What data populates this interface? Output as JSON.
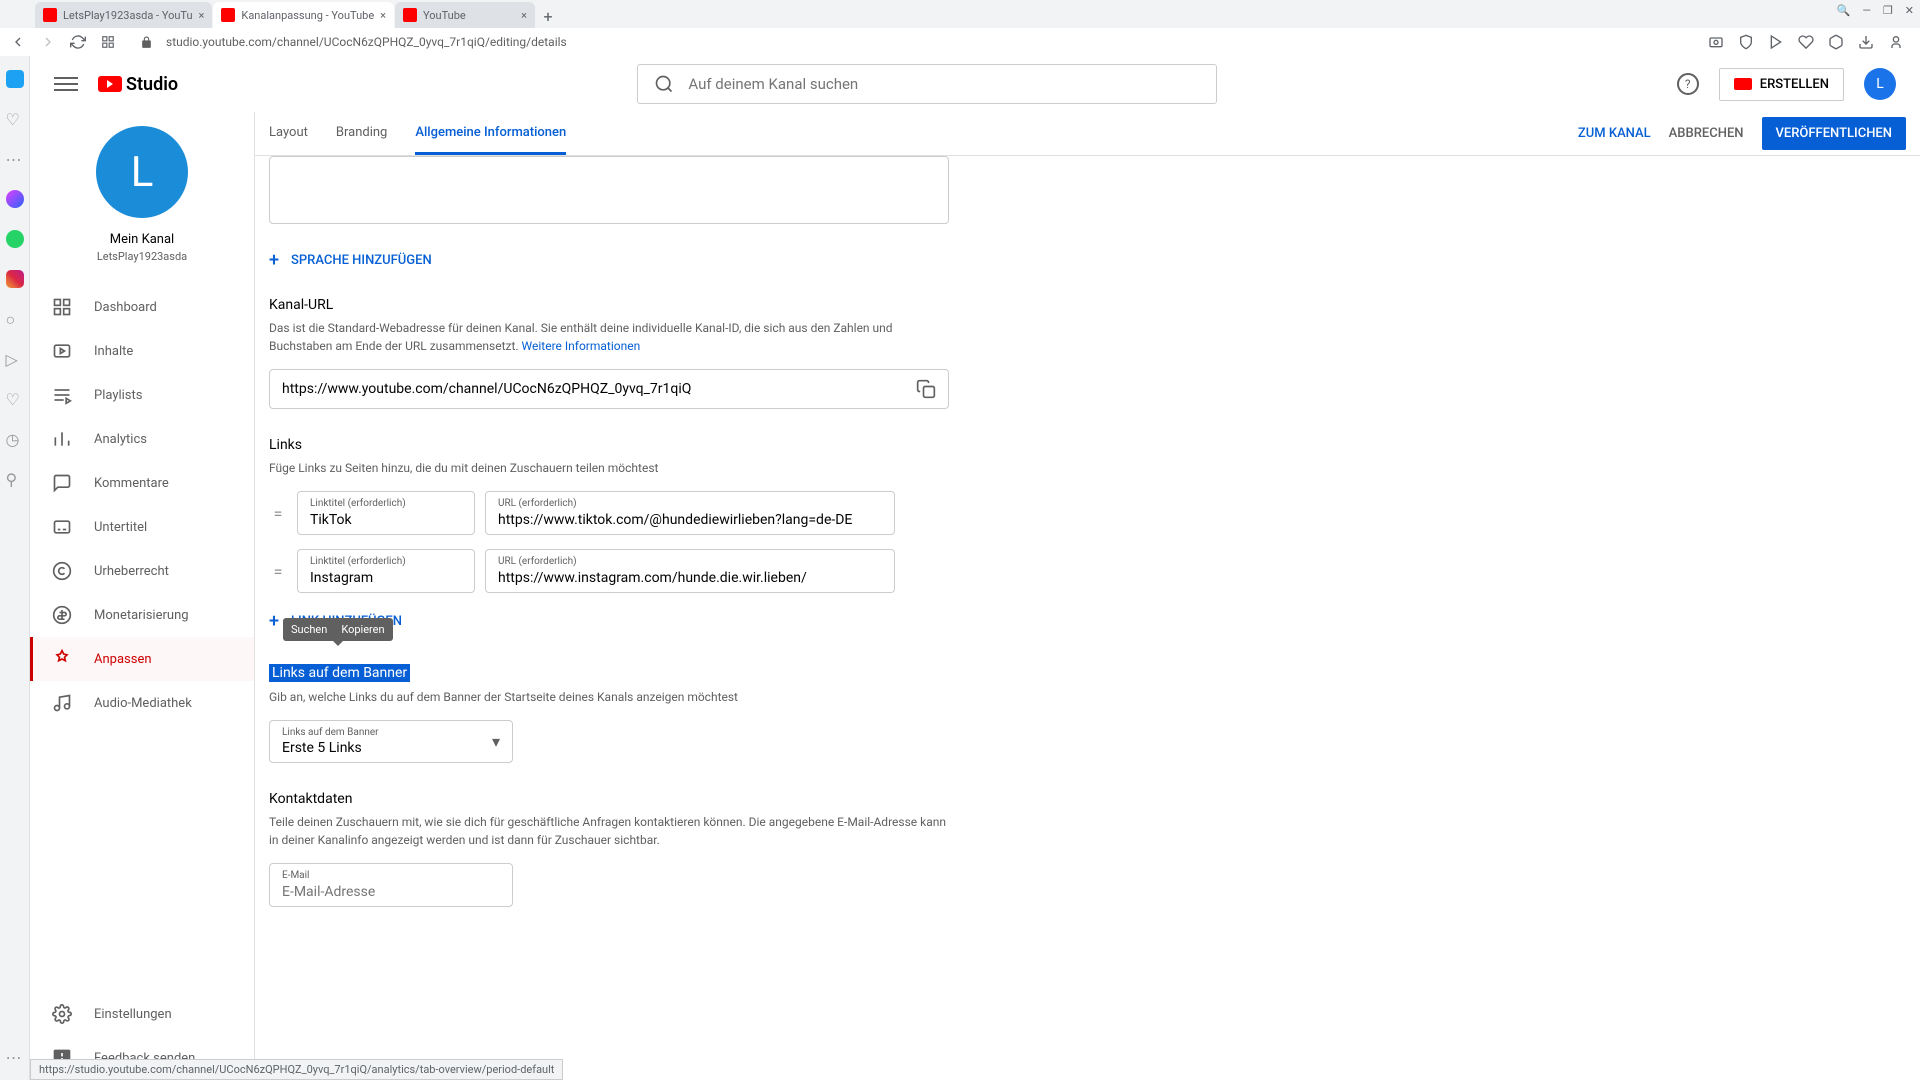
{
  "browser": {
    "tabs": [
      {
        "title": "LetsPlay1923asda - YouTu"
      },
      {
        "title": "Kanalanpassung - YouTube"
      },
      {
        "title": "YouTube"
      }
    ],
    "url": "studio.youtube.com/channel/UCocN6zQPHQZ_0yvq_7r1qiQ/editing/details",
    "window_controls": {
      "min": "—",
      "max": "❐",
      "close": "✕"
    }
  },
  "header": {
    "logo": "Studio",
    "search_placeholder": "Auf deinem Kanal suchen",
    "create_label": "ERSTELLEN",
    "avatar_letter": "L"
  },
  "channel": {
    "avatar_letter": "L",
    "title": "Mein Kanal",
    "name": "LetsPlay1923asda"
  },
  "nav": {
    "items": [
      {
        "label": "Dashboard"
      },
      {
        "label": "Inhalte"
      },
      {
        "label": "Playlists"
      },
      {
        "label": "Analytics"
      },
      {
        "label": "Kommentare"
      },
      {
        "label": "Untertitel"
      },
      {
        "label": "Urheberrecht"
      },
      {
        "label": "Monetarisierung"
      },
      {
        "label": "Anpassen"
      },
      {
        "label": "Audio-Mediathek"
      }
    ],
    "bottom": [
      {
        "label": "Einstellungen"
      },
      {
        "label": "Feedback senden"
      }
    ]
  },
  "tabs": {
    "items": [
      {
        "label": "Layout"
      },
      {
        "label": "Branding"
      },
      {
        "label": "Allgemeine Informationen"
      }
    ]
  },
  "actions": {
    "to_channel": "ZUM KANAL",
    "cancel": "ABBRECHEN",
    "publish": "VERÖFFENTLICHEN"
  },
  "content": {
    "add_language": "SPRACHE HINZUFÜGEN",
    "channel_url": {
      "title": "Kanal-URL",
      "desc": "Das ist die Standard-Webadresse für deinen Kanal. Sie enthält deine individuelle Kanal-ID, die sich aus den Zahlen und Buchstaben am Ende der URL zusammensetzt. ",
      "more_info": "Weitere Informationen",
      "value": "https://www.youtube.com/channel/UCocN6zQPHQZ_0yvq_7r1qiQ"
    },
    "links": {
      "title": "Links",
      "desc": "Füge Links zu Seiten hinzu, die du mit deinen Zuschauern teilen möchtest",
      "title_label": "Linktitel (erforderlich)",
      "url_label": "URL (erforderlich)",
      "rows": [
        {
          "title": "TikTok",
          "url": "https://www.tiktok.com/@hundediewirlieben?lang=de-DE"
        },
        {
          "title": "Instagram",
          "url": "https://www.instagram.com/hunde.die.wir.lieben/"
        }
      ],
      "add_link": "LINK HINZUFÜGEN"
    },
    "tooltip": {
      "search": "Suchen",
      "copy": "Kopieren"
    },
    "banner": {
      "title": "Links auf dem Banner",
      "desc": "Gib an, welche Links du auf dem Banner der Startseite deines Kanals anzeigen möchtest",
      "dropdown_label": "Links auf dem Banner",
      "dropdown_value": "Erste 5 Links"
    },
    "contact": {
      "title": "Kontaktdaten",
      "desc": "Teile deinen Zuschauern mit, wie sie dich für geschäftliche Anfragen kontaktieren können. Die angegebene E-Mail-Adresse kann in deiner Kanalinfo angezeigt werden und ist dann für Zuschauer sichtbar.",
      "email_label": "E-Mail",
      "email_placeholder": "E-Mail-Adresse"
    }
  },
  "status_bar": "https://studio.youtube.com/channel/UCocN6zQPHQZ_0yvq_7r1qiQ/analytics/tab-overview/period-default"
}
